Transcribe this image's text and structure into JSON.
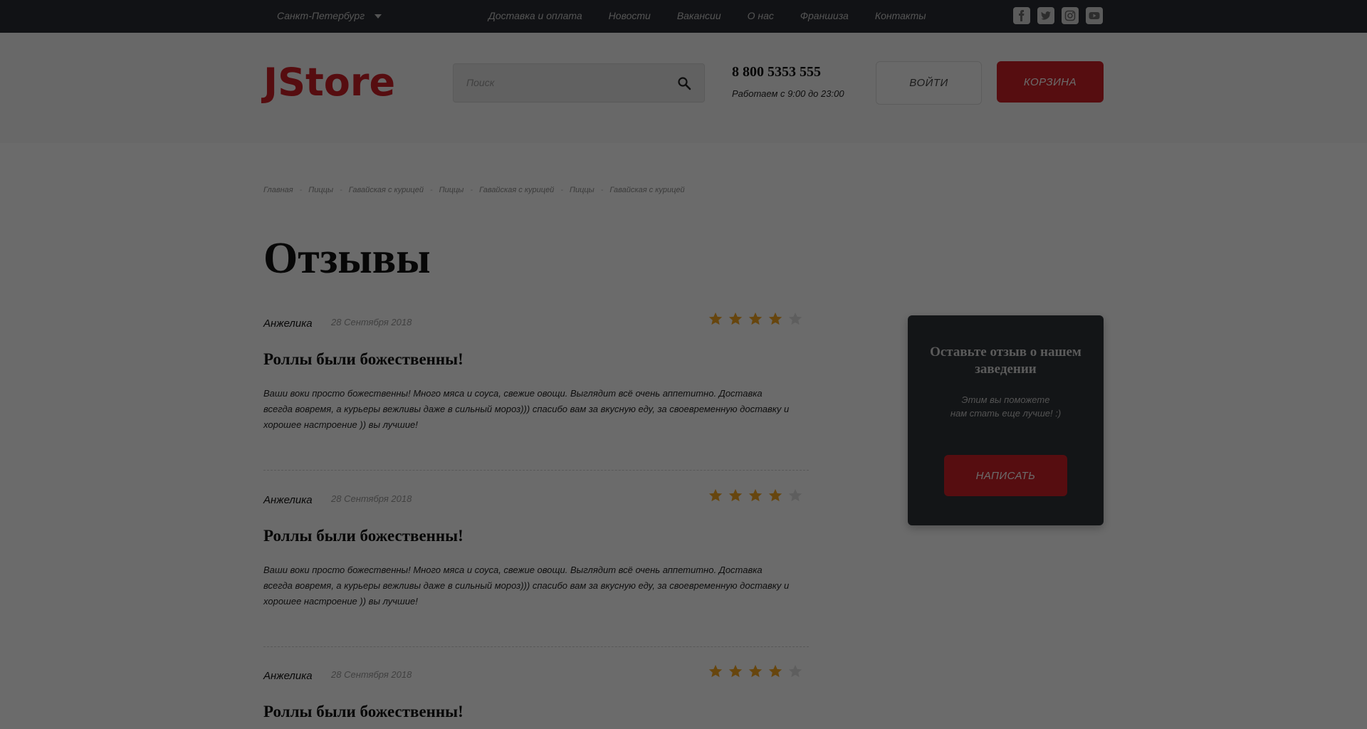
{
  "topbar": {
    "city": "Санкт-Петербург",
    "nav": [
      "Доставка и оплата",
      "Новости",
      "Вакансии",
      "О нас",
      "Франшиза",
      "Контакты"
    ],
    "socials": [
      "facebook-icon",
      "twitter-icon",
      "instagram-icon",
      "youtube-icon"
    ]
  },
  "header": {
    "logo": "JStore",
    "search_placeholder": "Поиск",
    "phone": "8 800 5353 555",
    "hours": "Работаем с 9:00 до 23:00",
    "login_label": "ВОЙТИ",
    "cart_label": "КОРЗИНА"
  },
  "breadcrumb": [
    "Главная",
    "Пиццы",
    "Гавайская с курицей",
    "Пиццы",
    "Гавайская с курицей",
    "Пиццы",
    "Гавайская с курицей"
  ],
  "page_title": "Отзывы",
  "reviews": [
    {
      "author": "Анжелика",
      "date": "28 Сентября 2018",
      "rating": 4,
      "max_rating": 5,
      "title": "Роллы были божественны!",
      "text": "Ваши воки просто божественны! Много мяса и соуса, свежие овощи. Выглядит всё очень аппетитно. Доставка всегда вовремя, а курьеры вежливы даже в сильный мороз))) спасибо вам за вкусную еду, за своевременную доставку и хорошее настроение )) вы лучшие!"
    },
    {
      "author": "Анжелика",
      "date": "28 Сентября 2018",
      "rating": 4,
      "max_rating": 5,
      "title": "Роллы были божественны!",
      "text": "Ваши воки просто божественны! Много мяса и соуса, свежие овощи. Выглядит всё очень аппетитно. Доставка всегда вовремя, а курьеры вежливы даже в сильный мороз))) спасибо вам за вкусную еду, за своевременную доставку и хорошее настроение )) вы лучшие!"
    },
    {
      "author": "Анжелика",
      "date": "28 Сентября 2018",
      "rating": 4,
      "max_rating": 5,
      "title": "Роллы были божественны!",
      "text": ""
    }
  ],
  "sidebox": {
    "title": "Оставьте отзыв о нашем заведении",
    "subtitle_line1": "Этим вы поможете",
    "subtitle_line2": "нам стать еще лучше! :)",
    "button_label": "НАПИСАТЬ"
  },
  "colors": {
    "accent": "#cc2027",
    "topbar": "#2a2d33",
    "star_active": "#f5a623",
    "star_inactive": "#e0e0e0"
  }
}
